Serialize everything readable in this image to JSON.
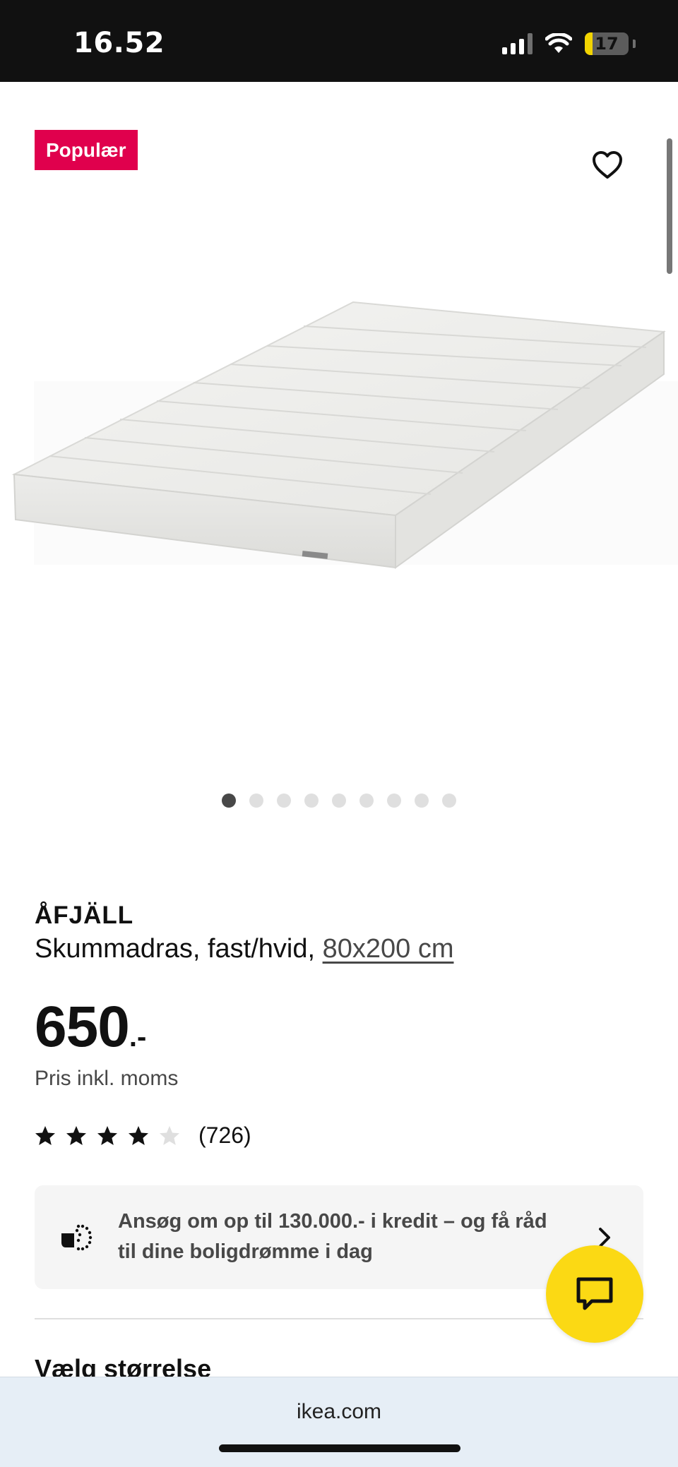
{
  "status_bar": {
    "time": "16.52",
    "battery": "17",
    "battery_level": 0.17
  },
  "gallery": {
    "badge": "Populær",
    "image_count": 9,
    "active_index": 0
  },
  "product": {
    "name": "ÅFJÄLL",
    "description_prefix": "Skummadras, fast/hvid, ",
    "size_link": "80x200 cm",
    "price": "650",
    "price_suffix": ".-",
    "price_note": "Pris inkl. moms",
    "rating_value": 4,
    "rating_max": 5,
    "review_count": "(726)"
  },
  "credit_banner": {
    "text": "Ansøg om op til 130.000.- i kredit – og få råd til dine boligdrømme i dag"
  },
  "size_section": {
    "heading": "Vælg størrelse"
  },
  "browser": {
    "url": "ikea.com"
  },
  "colors": {
    "badge": "#e0004d",
    "chat_button": "#fbd914",
    "browser_bar": "#e6eef6"
  }
}
